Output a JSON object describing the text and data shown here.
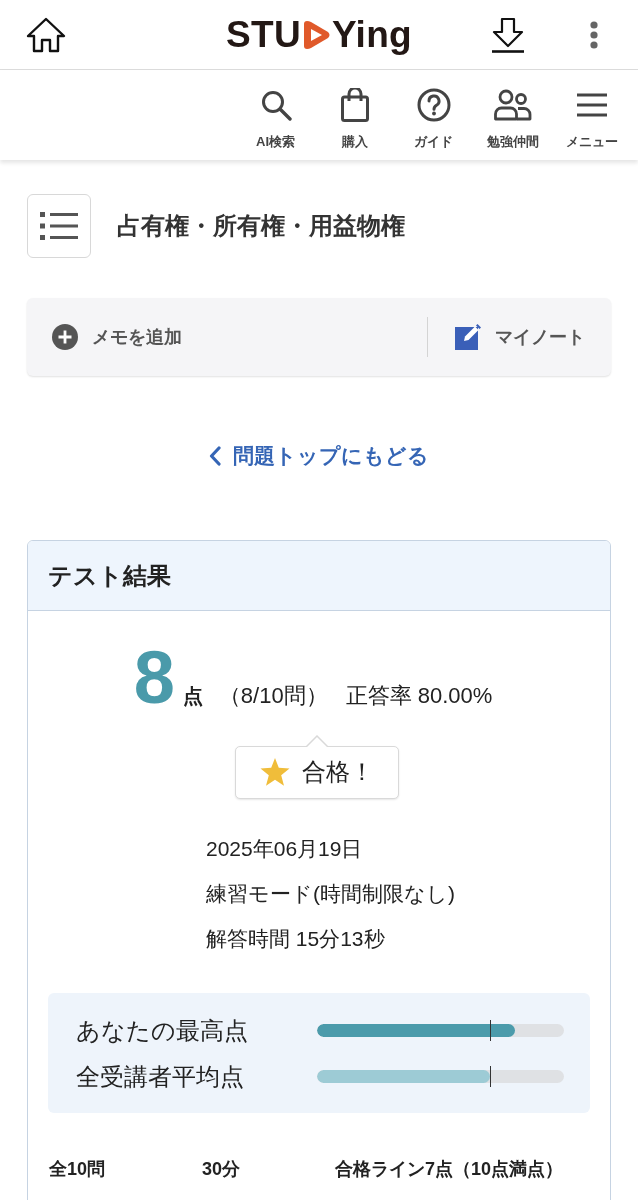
{
  "header": {
    "logo": {
      "text_before": "STU",
      "text_after": "Ying"
    }
  },
  "toolbar": {
    "items": [
      {
        "label": "AI検索"
      },
      {
        "label": "購入"
      },
      {
        "label": "ガイド"
      },
      {
        "label": "勉強仲間"
      },
      {
        "label": "メニュー"
      }
    ]
  },
  "title": "占有権・所有権・用益物権",
  "memo_bar": {
    "add_memo": "メモを追加",
    "my_note": "マイノート"
  },
  "back_link": "問題トップにもどる",
  "result_card": {
    "title": "テスト結果",
    "score": "8",
    "score_unit": "点",
    "count": "（8/10問）",
    "accuracy": "正答率 80.00%",
    "badge": "合格！",
    "info": [
      "2025年06月19日",
      "練習モード(時間制限なし)",
      "解答時間 15分13秒"
    ],
    "comparison": [
      {
        "label": "あなたの最高点",
        "level": 0.8,
        "color": "#4b9bab",
        "marker": {
          "level": 0.7
        }
      },
      {
        "label": "全受講者平均点",
        "level": 0.7,
        "color": "#9dcbd5",
        "marker": {
          "level": 0.7
        }
      }
    ],
    "summary": [
      "全10問",
      "30分",
      "合格ライン7点（10点満点）"
    ]
  }
}
